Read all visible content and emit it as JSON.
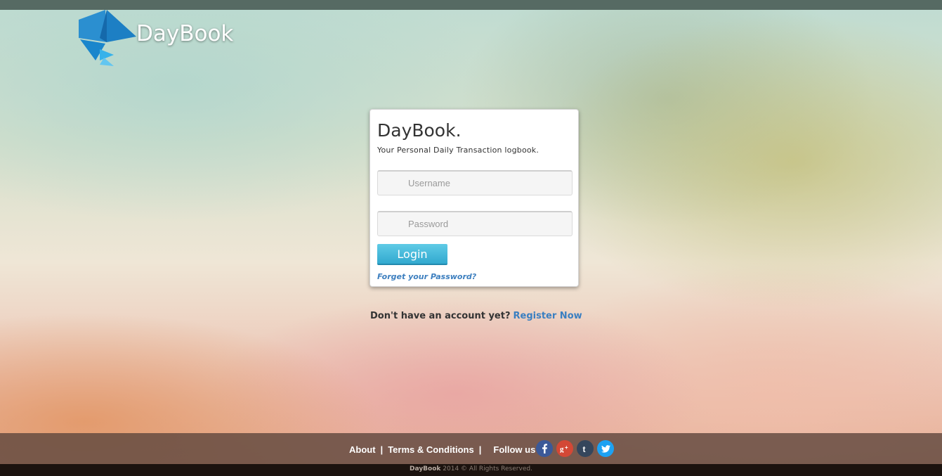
{
  "header": {
    "brand_name": "DayBook"
  },
  "login": {
    "title": "DayBook.",
    "subtitle": "Your Personal Daily Transaction logbook.",
    "username_placeholder": "Username",
    "password_placeholder": "Password",
    "login_label": "Login",
    "forgot_label": "Forget your Password?"
  },
  "register": {
    "prompt": "Don't have an account yet?",
    "link_label": "Register Now"
  },
  "footer": {
    "about_label": "About",
    "separator": "|",
    "terms_label": "Terms & Conditions",
    "follow_label": "Follow us :",
    "social": [
      {
        "icon": "facebook-icon",
        "glyph": "f",
        "color": "#3b5998"
      },
      {
        "icon": "google-plus-icon",
        "glyph": "g+",
        "color": "#d34836"
      },
      {
        "icon": "tumblr-icon",
        "glyph": "t",
        "color": "#35465c"
      },
      {
        "icon": "twitter-icon",
        "glyph": "bird",
        "color": "#1da1f2"
      }
    ],
    "copyright_brand": "DayBook",
    "copyright_text": "2014 © All Rights Reserved."
  },
  "colors": {
    "accent_button": "#3ab4d8",
    "link": "#3a7fc1",
    "footer_bg": "#60483e"
  }
}
